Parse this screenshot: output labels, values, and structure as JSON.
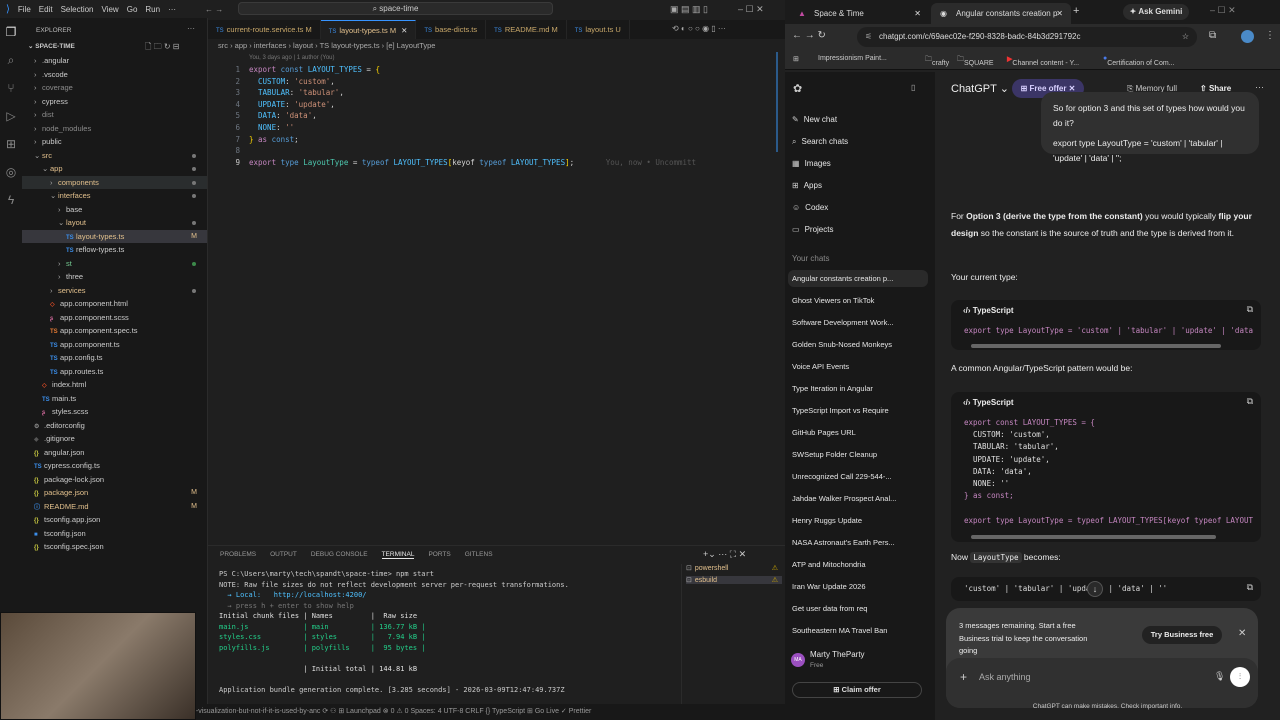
{
  "vscode": {
    "menu": [
      "File",
      "Edit",
      "Selection",
      "View",
      "Go",
      "Run",
      "···"
    ],
    "search": "space-time",
    "explorer_title": "EXPLORER",
    "root": "SPACE-TIME",
    "tree": [
      {
        "t": ".angular",
        "l": 0,
        "k": "folder"
      },
      {
        "t": ".vscode",
        "l": 0,
        "k": "folder"
      },
      {
        "t": "coverage",
        "l": 0,
        "k": "folder",
        "c": "#8b8b8b"
      },
      {
        "t": "cypress",
        "l": 0,
        "k": "folder"
      },
      {
        "t": "dist",
        "l": 0,
        "k": "folder",
        "c": "#8b8b8b"
      },
      {
        "t": "node_modules",
        "l": 0,
        "k": "folder",
        "c": "#8b8b8b"
      },
      {
        "t": "public",
        "l": 0,
        "k": "folder"
      },
      {
        "t": "src",
        "l": 0,
        "k": "open",
        "c": "#e2c08d",
        "dot": "#777"
      },
      {
        "t": "app",
        "l": 1,
        "k": "open",
        "c": "#e2c08d",
        "dot": "#777"
      },
      {
        "t": "components",
        "l": 2,
        "k": "folder",
        "c": "#e2c08d",
        "dot": "#777",
        "hover": true
      },
      {
        "t": "interfaces",
        "l": 2,
        "k": "open",
        "c": "#e2c08d",
        "dot": "#777"
      },
      {
        "t": "base",
        "l": 3,
        "k": "folder"
      },
      {
        "t": "layout",
        "l": 3,
        "k": "open",
        "c": "#e2c08d",
        "dot": "#777"
      },
      {
        "t": "layout-types.ts",
        "l": 4,
        "k": "ts",
        "c": "#e2c08d",
        "badge": "M",
        "sel": true
      },
      {
        "t": "reflow-types.ts",
        "l": 4,
        "k": "ts"
      },
      {
        "t": "st",
        "l": 3,
        "k": "folder",
        "c": "#73c991",
        "dot": "#3c8a4a"
      },
      {
        "t": "three",
        "l": 3,
        "k": "folder"
      },
      {
        "t": "services",
        "l": 2,
        "k": "folder",
        "c": "#e2c08d",
        "dot": "#777"
      },
      {
        "t": "app.component.html",
        "l": 2,
        "k": "html"
      },
      {
        "t": "app.component.scss",
        "l": 2,
        "k": "scss"
      },
      {
        "t": "app.component.spec.ts",
        "l": 2,
        "k": "spec"
      },
      {
        "t": "app.component.ts",
        "l": 2,
        "k": "ts"
      },
      {
        "t": "app.config.ts",
        "l": 2,
        "k": "ts"
      },
      {
        "t": "app.routes.ts",
        "l": 2,
        "k": "ts"
      },
      {
        "t": "index.html",
        "l": 1,
        "k": "html"
      },
      {
        "t": "main.ts",
        "l": 1,
        "k": "ts"
      },
      {
        "t": "styles.scss",
        "l": 1,
        "k": "scss"
      },
      {
        "t": ".editorconfig",
        "l": 0,
        "k": "gear"
      },
      {
        "t": ".gitignore",
        "l": 0,
        "k": "git"
      },
      {
        "t": "angular.json",
        "l": 0,
        "k": "json"
      },
      {
        "t": "cypress.config.ts",
        "l": 0,
        "k": "ts"
      },
      {
        "t": "package-lock.json",
        "l": 0,
        "k": "json"
      },
      {
        "t": "package.json",
        "l": 0,
        "k": "json",
        "c": "#e2c08d",
        "badge": "M"
      },
      {
        "t": "README.md",
        "l": 0,
        "k": "info",
        "c": "#e2c08d",
        "badge": "M"
      },
      {
        "t": "tsconfig.app.json",
        "l": 0,
        "k": "json"
      },
      {
        "t": "tsconfig.json",
        "l": 0,
        "k": "tsj"
      },
      {
        "t": "tsconfig.spec.json",
        "l": 0,
        "k": "json"
      }
    ],
    "tabs": [
      {
        "label": "current-route.service.ts M"
      },
      {
        "label": "layout-types.ts M",
        "active": true
      },
      {
        "label": "base-dicts.ts"
      },
      {
        "label": "README.md M"
      },
      {
        "label": "layout.ts U"
      }
    ],
    "breadcrumb": "src › app › interfaces › layout › TS layout-types.ts › [e] LayoutType",
    "blame": "You, 3 days ago | 1 author (You)",
    "code": [
      [
        [
          "export ",
          "kw"
        ],
        [
          "const ",
          "kb"
        ],
        [
          "LAYOUT_TYPES",
          "id"
        ],
        [
          " = ",
          "pl"
        ],
        [
          "{",
          "br"
        ]
      ],
      [
        [
          "  CUSTOM",
          "id"
        ],
        [
          ": ",
          "pl"
        ],
        [
          "'custom'",
          "st"
        ],
        [
          ",",
          "pl"
        ]
      ],
      [
        [
          "  TABULAR",
          "id"
        ],
        [
          ": ",
          "pl"
        ],
        [
          "'tabular'",
          "st"
        ],
        [
          ",",
          "pl"
        ]
      ],
      [
        [
          "  UPDATE",
          "id"
        ],
        [
          ": ",
          "pl"
        ],
        [
          "'update'",
          "st"
        ],
        [
          ",",
          "pl"
        ]
      ],
      [
        [
          "  DATA",
          "id"
        ],
        [
          ": ",
          "pl"
        ],
        [
          "'data'",
          "st"
        ],
        [
          ",",
          "pl"
        ]
      ],
      [
        [
          "  NONE",
          "id"
        ],
        [
          ": ",
          "pl"
        ],
        [
          "''",
          "st"
        ]
      ],
      [
        [
          "}",
          "br"
        ],
        [
          " as ",
          "kw"
        ],
        [
          "const",
          "kb"
        ],
        [
          ";",
          "pl"
        ]
      ],
      [],
      [
        [
          "export ",
          "kw"
        ],
        [
          "type ",
          "kb"
        ],
        [
          "LayoutType",
          "ty"
        ],
        [
          " = ",
          "pl"
        ],
        [
          "typeof ",
          "kb"
        ],
        [
          "LAYOUT_TYPES",
          "id"
        ],
        [
          "[",
          "br"
        ],
        [
          "keyof ",
          "pl"
        ],
        [
          "typeof ",
          "kb"
        ],
        [
          "LAYOUT_TYPES",
          "id"
        ],
        [
          "]",
          "br"
        ],
        [
          ";",
          "pl"
        ],
        [
          "       You, now • Uncommitt",
          "gh"
        ]
      ]
    ],
    "panel_tabs": [
      "PROBLEMS",
      "OUTPUT",
      "DEBUG CONSOLE",
      "TERMINAL",
      "PORTS",
      "GITLENS"
    ],
    "terminal": [
      {
        "t": "PS C:\\Users\\marty\\tech\\spandt\\space-time> npm start",
        "c": "#ccc"
      },
      {
        "t": "NOTE: Raw file sizes do not reflect development server per-request transformations.",
        "c": "#ccc"
      },
      {
        "t": "  → Local:   http://localhost:4200/",
        "c": "#4fc1ff"
      },
      {
        "t": "  → press h + enter to show help",
        "c": "#777"
      },
      {
        "t": "Initial chunk files | Names         |  Raw size",
        "c": "#e0e0e0"
      },
      {
        "t": "main.js             | main          | 136.77 kB |",
        "c": "#23d18b"
      },
      {
        "t": "styles.css          | styles        |   7.94 kB |",
        "c": "#23d18b"
      },
      {
        "t": "polyfills.js        | polyfills     |  95 bytes |",
        "c": "#23d18b"
      },
      {
        "t": "",
        "c": "#ccc"
      },
      {
        "t": "                    | Initial total | 144.81 kB",
        "c": "#e0e0e0"
      },
      {
        "t": "",
        "c": "#ccc"
      },
      {
        "t": "Application bundle generation complete. [3.285 seconds] - 2026-03-09T12:47:49.737Z",
        "c": "#ccc"
      }
    ],
    "terminals": [
      "powershell",
      "esbuild"
    ],
    "status": "d-visualization-but-not-if-it-is-used-by-anc ⟳   ⚇   ⊞ Launchpad   ⊗ 0 ⚠ 0          Spaces: 4   UTF-8   CRLF   {} TypeScript   ⊞   Go Live   ✓ Prettier"
  },
  "chrome": {
    "tabs": [
      "Space & Time",
      "Angular constants creation p"
    ],
    "ask_gemini": "Ask Gemini",
    "url": "chatgpt.com/c/69aec02e-f290-8328-badc-84b3d291792c",
    "bookmarks": [
      "Impressionism Paint...",
      "crafty",
      "SQUARE",
      "Channel content - Y...",
      "Certification of Com..."
    ]
  },
  "chatgpt": {
    "title": "ChatGPT ⌄",
    "free_offer": "Free offer",
    "memory": "Memory full",
    "share": "Share",
    "nav": [
      "New chat",
      "Search chats",
      "Images",
      "Apps",
      "Codex",
      "Projects"
    ],
    "your_chats": "Your chats",
    "chats": [
      "Angular constants creation p...",
      "Ghost Viewers on TikTok",
      "Software Development Work...",
      "Golden Snub-Nosed Monkeys",
      "Voice API Events",
      "Type Iteration in Angular",
      "TypeScript Import vs Require",
      "GitHub Pages URL",
      "SWSetup Folder Cleanup",
      "Unrecognized Call 229-544-...",
      "Jahdae Walker Prospect Anal...",
      "Henry Ruggs Update",
      "NASA Astronaut's Earth Pers...",
      "ATP and Mitochondria",
      "Iran War Update 2026",
      "Get user data from req",
      "Southeastern MA Travel Ban"
    ],
    "user": {
      "name": "Marty TheParty",
      "plan": "Free",
      "initials": "MA"
    },
    "claim": "Claim offer",
    "user_msg_1": "So for option 3 and this set of types how would you do it?",
    "user_msg_2": "export type LayoutType = 'custom' | 'tabular' | 'update' | 'data' | '';",
    "p1_a": "For ",
    "p1_b": "Option 3 (derive the type from the constant)",
    "p1_c": " you would typically ",
    "p1_d": "flip your design",
    "p1_e": " so the constant is the source of truth and the type is derived from it.",
    "p2": "Your current type:",
    "lang": "TypeScript",
    "code1": "export type LayoutType = 'custom' | 'tabular' | 'update' | 'data",
    "p3": "A common Angular/TypeScript pattern would be:",
    "code2": [
      "export const LAYOUT_TYPES = {",
      "  CUSTOM: 'custom',",
      "  TABULAR: 'tabular',",
      "  UPDATE: 'update',",
      "  DATA: 'data',",
      "  NONE: ''",
      "} as const;",
      "",
      "export type LayoutType = typeof LAYOUT_TYPES[keyof typeof LAYOUT"
    ],
    "p4_a": "Now",
    "p4_code": "LayoutType",
    "p4_b": "becomes:",
    "code3": "'custom' | 'tabular' | 'updat   | 'data' | ''",
    "banner": "3 messages remaining. Start a free Business trial to keep the conversation going",
    "try_btn": "Try Business free",
    "placeholder": "Ask anything",
    "disclaimer": "ChatGPT can make mistakes. Check important info."
  }
}
